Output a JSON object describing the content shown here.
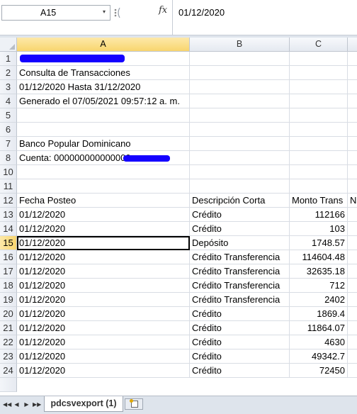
{
  "formula_bar": {
    "name_box": "A15",
    "name_box_arrow": "▾",
    "fx": "fx",
    "value": "01/12/2020"
  },
  "columns": [
    "A",
    "B",
    "C"
  ],
  "selected_column": "A",
  "selected_row": "15",
  "rows": [
    {
      "n": "1",
      "a": "",
      "b": "",
      "c": "",
      "redacted": true
    },
    {
      "n": "2",
      "a": "Consulta de Transacciones",
      "b": "",
      "c": ""
    },
    {
      "n": "3",
      "a": "01/12/2020 Hasta 31/12/2020",
      "b": "",
      "c": ""
    },
    {
      "n": "4",
      "a": "Generado el 07/05/2021 09:57:12 a. m.",
      "b": "",
      "c": ""
    },
    {
      "n": "5",
      "a": "",
      "b": "",
      "c": ""
    },
    {
      "n": "6",
      "a": "",
      "b": "",
      "c": ""
    },
    {
      "n": "7",
      "a": "Banco Popular Dominicano",
      "b": "",
      "c": ""
    },
    {
      "n": "8",
      "a": "Cuenta: 000000000000000",
      "b": "",
      "c": "",
      "redacted": true
    },
    {
      "n": "10",
      "a": "",
      "b": "",
      "c": ""
    },
    {
      "n": "11",
      "a": "",
      "b": "",
      "c": ""
    },
    {
      "n": "12",
      "a": "Fecha Posteo",
      "b": "Descripción Corta",
      "c": "Monto Trans",
      "d": "Nu"
    },
    {
      "n": "13",
      "a": "01/12/2020",
      "b": "Crédito",
      "c": "112166"
    },
    {
      "n": "14",
      "a": "01/12/2020",
      "b": "Crédito",
      "c": "103"
    },
    {
      "n": "15",
      "a": "01/12/2020",
      "b": "Depósito",
      "c": "1748.57"
    },
    {
      "n": "16",
      "a": "01/12/2020",
      "b": "Crédito Transferencia",
      "c": "114604.48"
    },
    {
      "n": "17",
      "a": "01/12/2020",
      "b": "Crédito Transferencia",
      "c": "32635.18"
    },
    {
      "n": "18",
      "a": "01/12/2020",
      "b": "Crédito Transferencia",
      "c": "712"
    },
    {
      "n": "19",
      "a": "01/12/2020",
      "b": "Crédito Transferencia",
      "c": "2402"
    },
    {
      "n": "20",
      "a": "01/12/2020",
      "b": "Crédito",
      "c": "1869.4"
    },
    {
      "n": "21",
      "a": "01/12/2020",
      "b": "Crédito",
      "c": "11864.07"
    },
    {
      "n": "22",
      "a": "01/12/2020",
      "b": "Crédito",
      "c": "4630"
    },
    {
      "n": "23",
      "a": "01/12/2020",
      "b": "Crédito",
      "c": "49342.7"
    },
    {
      "n": "24",
      "a": "01/12/2020",
      "b": "Crédito",
      "c": "72450"
    }
  ],
  "sheet_tabs": {
    "active": "pdcsvexport (1)",
    "nav": [
      "◀◀",
      "◀",
      "▶",
      "▶▶"
    ]
  },
  "colors": {
    "redaction": "#1400ff",
    "selected_header": "#f8d56e"
  }
}
